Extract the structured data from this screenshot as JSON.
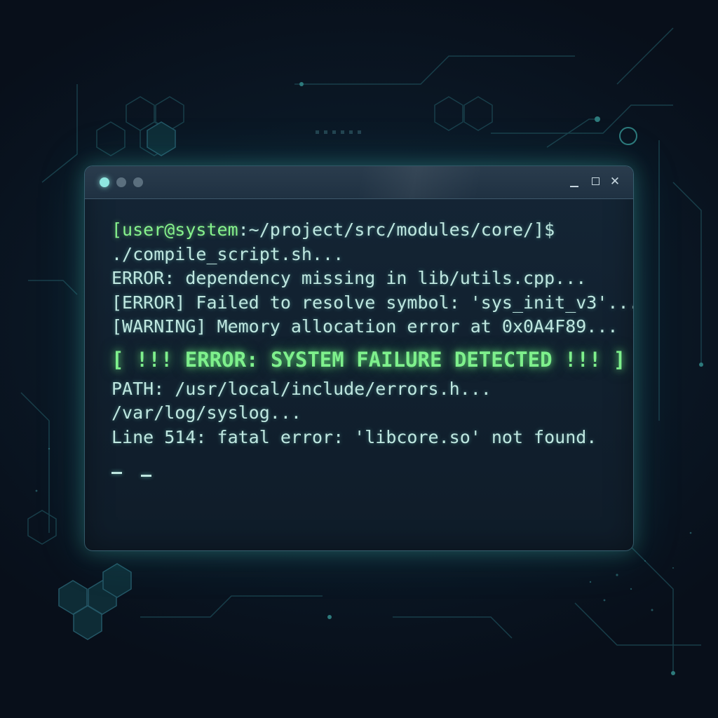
{
  "window": {
    "controls": {
      "minimize_icon": "minimize-icon",
      "maximize_icon": "maximize-icon",
      "close_icon": "close-icon"
    },
    "traffic_lights": [
      "active",
      "inactive",
      "inactive"
    ]
  },
  "terminal": {
    "prompt_user": "[user@system",
    "prompt_path": ":~/project/src/modules/core/]$",
    "lines": [
      "./compile_script.sh...",
      "ERROR: dependency missing in lib/utils.cpp...",
      "[ERROR] Failed to resolve symbol: 'sys_init_v3'...",
      "[WARNING] Memory allocation error at 0x0A4F89..."
    ],
    "alert": "[ !!! ERROR: SYSTEM FAILURE DETECTED !!! ]",
    "after_lines": [
      "PATH: /usr/local/include/errors.h...",
      "/var/log/syslog...",
      "Line 514: fatal error: 'libcore.so' not found."
    ]
  },
  "colors": {
    "background": "#0a1220",
    "text": "#bfe7e0",
    "prompt_user": "#86f28c",
    "alert": "#7ef08c",
    "window_border": "#78c8dc"
  }
}
